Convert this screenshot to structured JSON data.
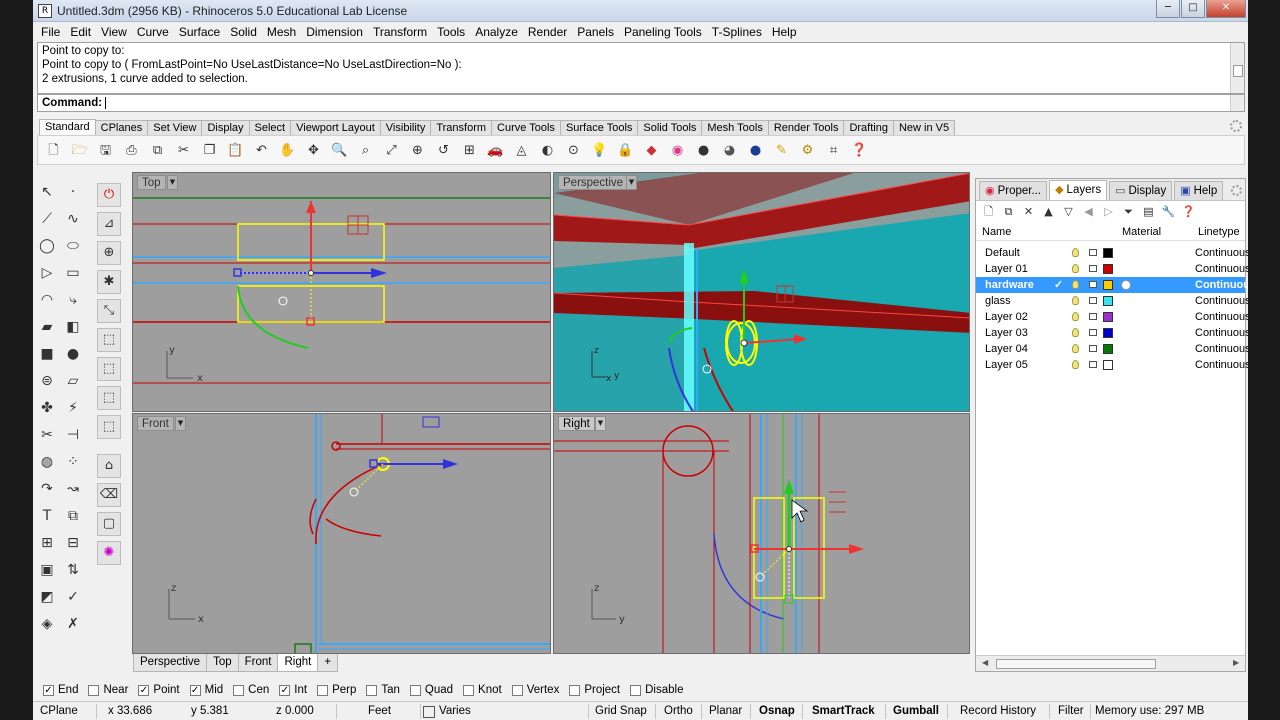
{
  "window": {
    "title": "Untitled.3dm (2956 KB) - Rhinoceros 5.0 Educational Lab License",
    "app_icon": "R",
    "minimize": "─",
    "restore": "□",
    "close": "✕"
  },
  "menu": [
    "File",
    "Edit",
    "View",
    "Curve",
    "Surface",
    "Solid",
    "Mesh",
    "Dimension",
    "Transform",
    "Tools",
    "Analyze",
    "Render",
    "Panels",
    "Paneling Tools",
    "T-Splines",
    "Help"
  ],
  "command_history": [
    "Point to copy to:",
    "Point to copy to ( FromLastPoint=No  UseLastDistance=No  UseLastDirection=No ):",
    "2 extrusions, 1 curve added to selection."
  ],
  "command_prompt": "Command:",
  "toolbar_tabs": [
    "Standard",
    "CPlanes",
    "Set View",
    "Display",
    "Select",
    "Viewport Layout",
    "Visibility",
    "Transform",
    "Curve Tools",
    "Surface Tools",
    "Solid Tools",
    "Mesh Tools",
    "Render Tools",
    "Drafting",
    "New in V5"
  ],
  "active_toolbar_tab": "Standard",
  "standard_toolbar_icons": [
    "new-icon",
    "open-icon",
    "save-icon",
    "print-icon",
    "import-icon",
    "cut-icon",
    "copy-icon",
    "paste-icon",
    "undo-icon",
    "pan-icon",
    "rotate-view-icon",
    "zoom-icon",
    "zoom-window-icon",
    "zoom-extents-icon",
    "zoom-selected-icon",
    "undo-view-icon",
    "four-viewports-icon",
    "car-icon",
    "wireframe-icon",
    "ghosted-icon",
    "osnap-point-icon",
    "light-icon",
    "lock-icon",
    "layer-icon",
    "color-wheel-icon",
    "render-sphere-icon",
    "render-preview-icon",
    "material-sphere-icon",
    "properties-icon",
    "gear-tool-icon",
    "grid-tool-icon",
    "help-icon"
  ],
  "viewports": {
    "top": {
      "label": "Top",
      "axis_x": "x",
      "axis_y": "y"
    },
    "perspective": {
      "label": "Perspective",
      "axis_x": "x",
      "axis_y": "y",
      "axis_z": "z"
    },
    "front": {
      "label": "Front",
      "axis_x": "x",
      "axis_y": "z"
    },
    "right": {
      "label": "Right",
      "axis_x": "y",
      "axis_y": "z"
    }
  },
  "viewport_tabs": [
    "Perspective",
    "Top",
    "Front",
    "Right",
    "+"
  ],
  "active_viewport_tab": "Right",
  "panel": {
    "tabs": [
      {
        "label": "Proper...",
        "icon": "properties-icon"
      },
      {
        "label": "Layers",
        "icon": "layers-icon"
      },
      {
        "label": "Display",
        "icon": "display-icon"
      },
      {
        "label": "Help",
        "icon": "help-icon"
      }
    ],
    "active_tab": "Layers",
    "columns": [
      "Name",
      "Material",
      "Linetype"
    ],
    "layers": [
      {
        "name": "Default",
        "current": false,
        "color": "#000000",
        "linetype": "Continuous",
        "selected": false
      },
      {
        "name": "Layer 01",
        "current": false,
        "color": "#cc0000",
        "linetype": "Continuous",
        "selected": false
      },
      {
        "name": "hardware",
        "current": true,
        "color": "#ffcc00",
        "linetype": "Continuous",
        "selected": true
      },
      {
        "name": "glass",
        "current": false,
        "color": "#33e6f0",
        "linetype": "Continuous",
        "selected": false
      },
      {
        "name": "Layer 02",
        "current": false,
        "color": "#9933cc",
        "linetype": "Continuous",
        "selected": false
      },
      {
        "name": "Layer 03",
        "current": false,
        "color": "#0000cc",
        "linetype": "Continuous",
        "selected": false
      },
      {
        "name": "Layer 04",
        "current": false,
        "color": "#007a00",
        "linetype": "Continuous",
        "selected": false
      },
      {
        "name": "Layer 05",
        "current": false,
        "color": "#ffffff",
        "linetype": "Continuous",
        "selected": false
      }
    ],
    "current_mark": "✓"
  },
  "osnaps": [
    {
      "label": "End",
      "checked": true
    },
    {
      "label": "Near",
      "checked": false
    },
    {
      "label": "Point",
      "checked": true
    },
    {
      "label": "Mid",
      "checked": true
    },
    {
      "label": "Cen",
      "checked": false
    },
    {
      "label": "Int",
      "checked": true
    },
    {
      "label": "Perp",
      "checked": false
    },
    {
      "label": "Tan",
      "checked": false
    },
    {
      "label": "Quad",
      "checked": false
    },
    {
      "label": "Knot",
      "checked": false
    },
    {
      "label": "Vertex",
      "checked": false
    },
    {
      "label": "Project",
      "checked": false
    },
    {
      "label": "Disable",
      "checked": false
    }
  ],
  "status": {
    "cplane": "CPlane",
    "x": "x 33.686",
    "y": "y 5.381",
    "z": "z 0.000",
    "units": "Feet",
    "layer_value": "Varies",
    "grid_snap": "Grid Snap",
    "ortho": "Ortho",
    "planar": "Planar",
    "osnap": "Osnap",
    "smarttrack": "SmartTrack",
    "gumball": "Gumball",
    "record_history": "Record History",
    "filter": "Filter",
    "memory": "Memory use: 297 MB"
  }
}
